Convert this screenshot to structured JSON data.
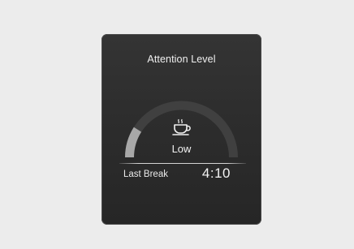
{
  "panel": {
    "title": "Attention Level",
    "gauge": {
      "level_fraction": 0.18,
      "icon": "coffee-cup-icon",
      "level_label": "Low",
      "colors": {
        "track": "#404040",
        "fill": "#a8a8a8"
      }
    },
    "last_break": {
      "label": "Last Break",
      "value": "4:10"
    }
  }
}
